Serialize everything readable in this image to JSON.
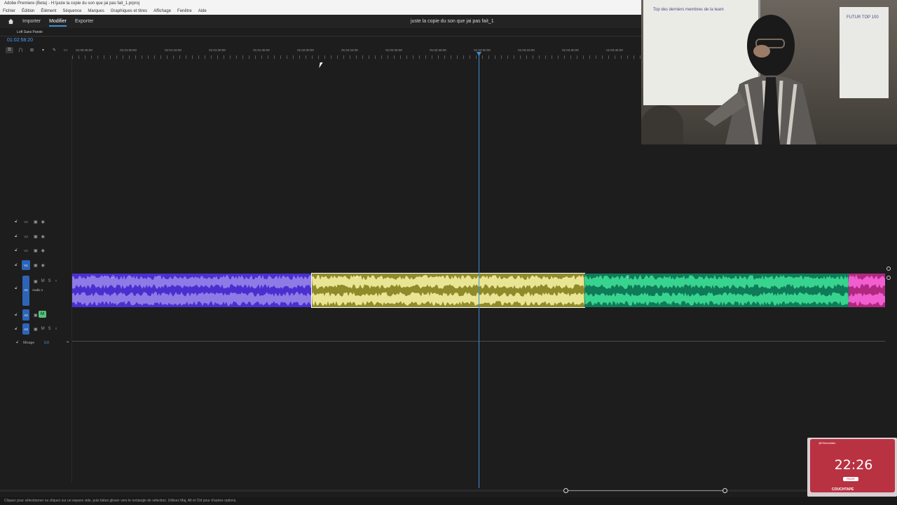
{
  "window": {
    "title": "Adobe Premiere (Beta) - H:\\juste la copie du son que jai pas fait_1.prproj"
  },
  "menu": [
    "Fichier",
    "Édition",
    "Élément",
    "Séquence",
    "Marques",
    "Graphiques et titres",
    "Affichage",
    "Fenêtre",
    "Aide"
  ],
  "nav": {
    "tabs": [
      {
        "label": "Importer",
        "active": false
      },
      {
        "label": "Modifier",
        "active": true
      },
      {
        "label": "Exporter",
        "active": false
      }
    ],
    "project_title": "juste la copie du son que jai pas fait_1"
  },
  "sequence": {
    "name": "Loft Sans Parole",
    "timecode": "01:02:58:20",
    "ruler_labels": [
      "01:00:45:00",
      "01:01:00:00",
      "01:01:15:00",
      "01:01:30:00",
      "01:01:45:00",
      "01:02:00:00",
      "01:02:15:00",
      "01:02:30:00",
      "01:02:45:00",
      "01:03:00:00",
      "01:03:15:00",
      "01:03:30:00",
      "01:03:45:00"
    ]
  },
  "tracks": {
    "video": [
      "V4",
      "V3",
      "V2",
      "V1"
    ],
    "audio": [
      "A1",
      "A2",
      "A3"
    ],
    "a1_name": "Audio 1",
    "a2_mute": "M",
    "mix_label": "Mixage",
    "mix_value": "0,0"
  },
  "clips": [
    {
      "name": "clip-purple",
      "color": "#8f7be6",
      "dark": "#4a2fd0"
    },
    {
      "name": "clip-yellow",
      "color": "#e9e594",
      "dark": "#8f8a2a"
    },
    {
      "name": "clip-green",
      "color": "#38d48f",
      "dark": "#0f7a58"
    },
    {
      "name": "clip-pink",
      "color": "#f05ed0",
      "dark": "#b0287f"
    }
  ],
  "status": "Cliquez pour sélectionner ou cliquez sur un espace vide, puis faites glisser vers le rectangle de sélection. Utilisez Maj, Alt et Ctrl pour d'autres options.",
  "webcam": {
    "board_text": "Top des derniers membres de la team",
    "board2_text": "FUTUR TOP 100"
  },
  "overlay": {
    "brand": "@Streamlabs",
    "clock": "22:26",
    "pill": "PAUSE",
    "name": "COUCHTAPE"
  },
  "colors": {
    "accent": "#3e8ed0",
    "target": "#2d64b8"
  }
}
